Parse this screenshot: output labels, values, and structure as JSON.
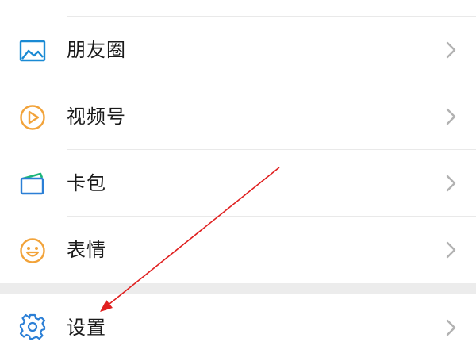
{
  "menu": {
    "items": [
      {
        "key": "moments",
        "label": "朋友圈",
        "icon": "moments-image-icon",
        "color": "#1a8ad4"
      },
      {
        "key": "channels",
        "label": "视频号",
        "icon": "channels-play-icon",
        "color": "#f2a33a"
      },
      {
        "key": "wallet",
        "label": "卡包",
        "icon": "card-wallet-icon",
        "color": "#2b7fd6"
      },
      {
        "key": "stickers",
        "label": "表情",
        "icon": "sticker-smile-icon",
        "color": "#f2a33a"
      }
    ],
    "settings": {
      "label": "设置",
      "icon": "gear-icon",
      "color": "#2b7fd6"
    }
  },
  "annotation": {
    "color": "#e02020",
    "target": "settings-row"
  },
  "colors": {
    "chevron": "#b2b2b2",
    "divider": "#e9e9e9",
    "section_gap": "#ececec",
    "text": "#1a1a1a"
  }
}
